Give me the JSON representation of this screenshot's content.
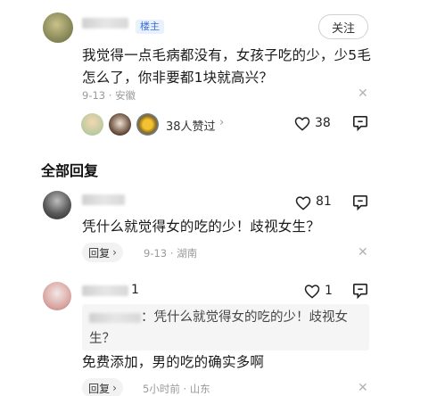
{
  "post": {
    "author_badge": "楼主",
    "follow_label": "关注",
    "text": "我觉得一点毛病都没有，女孩子吃的少，少5毛怎么了，你非要都1块就高兴？",
    "date": "9-13",
    "location": "安徽",
    "likes_summary": "38人赞过",
    "like_count": "38"
  },
  "section": {
    "title": "全部回复"
  },
  "replies": [
    {
      "name_suffix": "",
      "like_count": "81",
      "text": "凭什么就觉得女的吃的少！歧视女生？",
      "reply_label": "回复",
      "date": "9-13",
      "location": "湖南"
    },
    {
      "name_suffix": "1",
      "like_count": "1",
      "quote_text": "：凭什么就觉得女的吃的少！歧视女生？",
      "text": "免费添加，男的吃的确实多啊",
      "reply_label": "回复",
      "time": "5小时前",
      "location": "山东"
    }
  ],
  "colors": {
    "badge_bg": "#e9f1ff",
    "badge_text": "#3b6fd8",
    "meta": "#9a9a9a"
  }
}
